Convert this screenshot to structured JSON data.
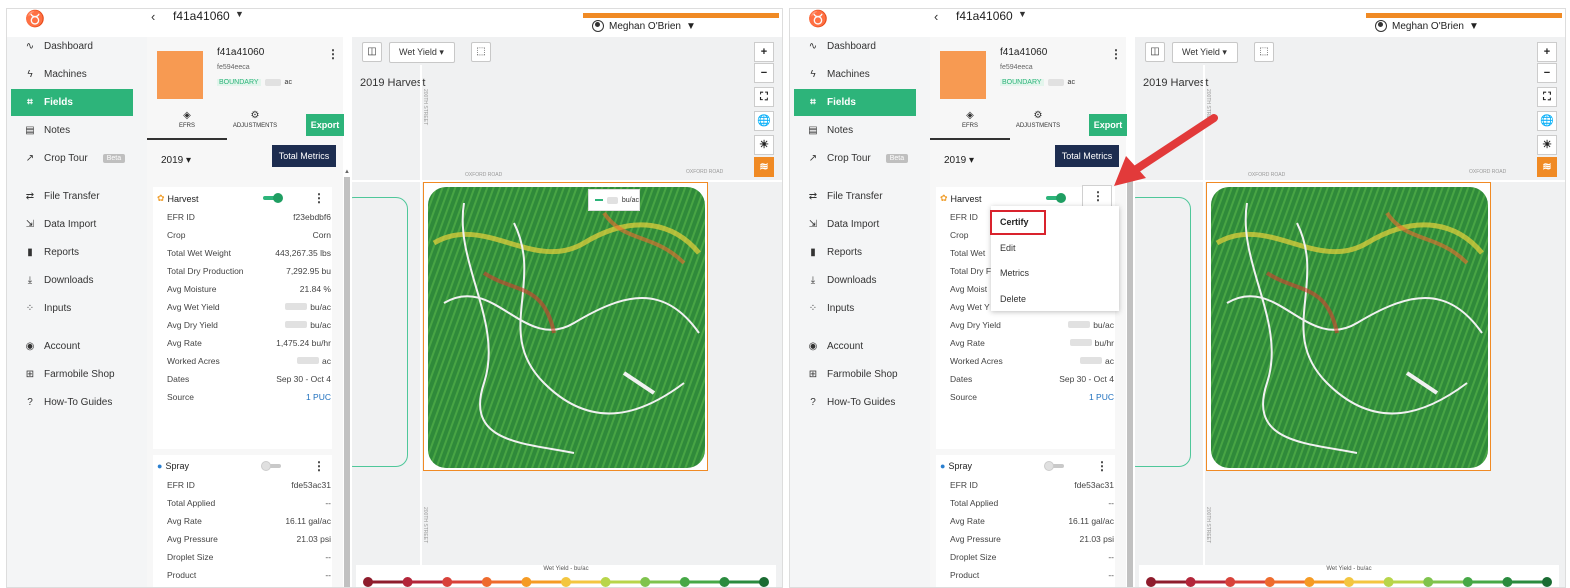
{
  "window": {
    "field_title": "f41a41060"
  },
  "user": {
    "name": "Meghan O'Brien"
  },
  "nav": {
    "items": [
      {
        "label": "Dashboard",
        "icon": "pulse-icon"
      },
      {
        "label": "Machines",
        "icon": "bolt-icon"
      },
      {
        "label": "Fields",
        "icon": "field-icon"
      },
      {
        "label": "Notes",
        "icon": "notes-icon"
      },
      {
        "label": "Crop Tour",
        "icon": "trend-icon"
      },
      {
        "label": "File Transfer",
        "icon": "transfer-icon"
      },
      {
        "label": "Data Import",
        "icon": "import-icon"
      },
      {
        "label": "Reports",
        "icon": "bar-chart-icon"
      },
      {
        "label": "Downloads",
        "icon": "download-icon"
      },
      {
        "label": "Inputs",
        "icon": "inputs-icon"
      },
      {
        "label": "Account",
        "icon": "account-icon"
      },
      {
        "label": "Farmobile Shop",
        "icon": "cart-icon"
      },
      {
        "label": "How-To Guides",
        "icon": "help-icon"
      }
    ],
    "active": "Fields",
    "beta_label": "Beta"
  },
  "card": {
    "name": "f41a41060",
    "sub_id": "fe594eeca",
    "boundary_label": "BOUNDARY",
    "acres_unit": "ac",
    "tabs": [
      {
        "label": "EFRS",
        "icon": "layers-icon"
      },
      {
        "label": "ADJUSTMENTS",
        "icon": "gear-icon"
      }
    ],
    "export_label": "Export",
    "year": "2019",
    "total_metrics_label": "Total Metrics"
  },
  "harvest": {
    "title": "Harvest",
    "enabled": true,
    "rows": [
      {
        "k": "EFR ID",
        "v": "f23ebdbf6"
      },
      {
        "k": "Crop",
        "v": "Corn"
      },
      {
        "k": "Total Wet Weight",
        "v": "443,267.35 lbs"
      },
      {
        "k": "Total Dry Production",
        "v": "7,292.95 bu"
      },
      {
        "k": "Avg Moisture",
        "v": "21.84 %"
      },
      {
        "k": "Avg Wet Yield",
        "v": "bu/ac"
      },
      {
        "k": "Avg Dry Yield",
        "v": "bu/ac"
      },
      {
        "k": "Avg Rate",
        "v": "1,475.24 bu/hr"
      },
      {
        "k": "Worked Acres",
        "v": "ac"
      },
      {
        "k": "Dates",
        "v": "Sep 30 - Oct 4"
      },
      {
        "k": "Source",
        "v": "1 PUC"
      }
    ],
    "rows_right": [
      {
        "k": "EFR ID",
        "v": ""
      },
      {
        "k": "Crop",
        "v": ""
      },
      {
        "k": "Total Wet",
        "v": ""
      },
      {
        "k": "Total Dry F",
        "v": ""
      },
      {
        "k": "Avg Moist",
        "v": ""
      },
      {
        "k": "Avg Wet Y",
        "v": ""
      },
      {
        "k": "Avg Dry Yield",
        "v": "bu/ac"
      },
      {
        "k": "Avg Rate",
        "v": "bu/hr"
      },
      {
        "k": "Worked Acres",
        "v": "ac"
      },
      {
        "k": "Dates",
        "v": "Sep 30 - Oct 4"
      },
      {
        "k": "Source",
        "v": "1 PUC"
      }
    ]
  },
  "spray": {
    "title": "Spray",
    "enabled": false,
    "rows": [
      {
        "k": "EFR ID",
        "v": "fde53ac31"
      },
      {
        "k": "Total Applied",
        "v": "--"
      },
      {
        "k": "Avg Rate",
        "v": "16.11 gal/ac"
      },
      {
        "k": "Avg Pressure",
        "v": "21.03 psi"
      },
      {
        "k": "Droplet Size",
        "v": "--"
      },
      {
        "k": "Product",
        "v": "--"
      }
    ]
  },
  "map": {
    "layer": "Wet Yield",
    "harvest_title": "2019 Harvest",
    "roads": {
      "oxford": "OXFORD ROAD",
      "street": "200TH STREET"
    },
    "legend_unit": "bu/ac",
    "scale_title": "Wet Yield - bu/ac",
    "scale_colors": [
      "#8e1c2c",
      "#b3263a",
      "#d8423a",
      "#ee6b2d",
      "#f59b24",
      "#f3c640",
      "#b8d54a",
      "#7fc34d",
      "#46a846",
      "#2a8b3e",
      "#1a6b32"
    ],
    "controls": [
      "+",
      "−",
      "⛶",
      "🌐",
      "☀",
      "≋"
    ]
  },
  "context_menu": {
    "items": [
      "Certify",
      "Edit",
      "Metrics",
      "Delete"
    ]
  },
  "colors": {
    "brand_green": "#2db47a",
    "accent_orange": "#f08a24",
    "navy": "#1d2d50",
    "highlight_red": "#d9232d"
  }
}
